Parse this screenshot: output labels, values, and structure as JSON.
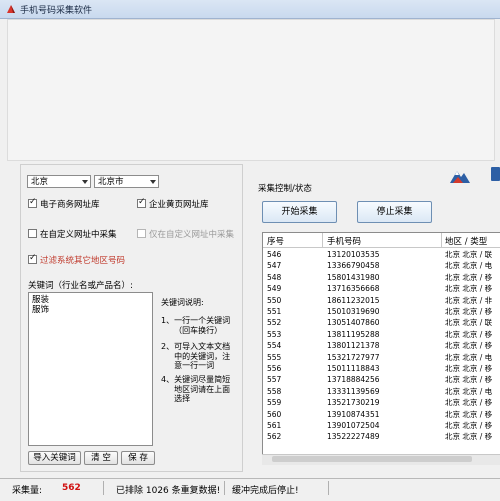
{
  "window": {
    "title": "手机号码采集软件"
  },
  "left": {
    "province_select": "北京",
    "city_select": "北京市",
    "options": {
      "ecommerce": {
        "label": "电子商务网址库",
        "checked": true
      },
      "yellowpages": {
        "label": "企业黄页网址库",
        "checked": true
      },
      "custom_url": {
        "label": "在自定义网址中采集",
        "checked": false
      },
      "custom_only": {
        "label": "仅在自定义网址中采集",
        "checked": false
      },
      "filter_other": {
        "label": "过滤系统其它地区号码",
        "checked": true
      }
    },
    "keywords_label": "关键词（行业名或产品名）:",
    "keywords_lines": [
      "服装",
      "服饰"
    ],
    "help_title": "关键词说明:",
    "help_items": [
      {
        "num": "1、",
        "lines": [
          "一行一个关键词",
          "（回车换行）"
        ]
      },
      {
        "num": "2、",
        "lines": [
          "可导入文本文档",
          "中的关键词，注",
          "意一行一词"
        ]
      },
      {
        "num": "4、",
        "lines": [
          "关键词尽量简短",
          "地区词请在上面",
          "选择"
        ]
      }
    ],
    "buttons": {
      "import": "导入关键词",
      "clear": "清 空",
      "save": "保 存"
    }
  },
  "right": {
    "section_title": "采集控制/状态",
    "start_button": "开始采集",
    "stop_button": "停止采集",
    "columns": [
      "序号",
      "手机号码",
      "地区 / 类型"
    ],
    "rows": [
      {
        "no": "546",
        "phone": "13120103535",
        "region": "北京 北京 / 联"
      },
      {
        "no": "547",
        "phone": "13366790458",
        "region": "北京 北京 / 电"
      },
      {
        "no": "548",
        "phone": "15801431980",
        "region": "北京 北京 / 移"
      },
      {
        "no": "549",
        "phone": "13716356668",
        "region": "北京 北京 / 移"
      },
      {
        "no": "550",
        "phone": "18611232015",
        "region": "北京 北京 / 非"
      },
      {
        "no": "551",
        "phone": "15010319690",
        "region": "北京 北京 / 移"
      },
      {
        "no": "552",
        "phone": "13051407860",
        "region": "北京 北京 / 联"
      },
      {
        "no": "553",
        "phone": "13811195288",
        "region": "北京 北京 / 移"
      },
      {
        "no": "554",
        "phone": "13801121378",
        "region": "北京 北京 / 移"
      },
      {
        "no": "555",
        "phone": "15321727977",
        "region": "北京 北京 / 电"
      },
      {
        "no": "556",
        "phone": "15011118843",
        "region": "北京 北京 / 移"
      },
      {
        "no": "557",
        "phone": "13718884256",
        "region": "北京 北京 / 移"
      },
      {
        "no": "558",
        "phone": "13331139569",
        "region": "北京 北京 / 电"
      },
      {
        "no": "559",
        "phone": "13521730219",
        "region": "北京 北京 / 移"
      },
      {
        "no": "560",
        "phone": "13910874351",
        "region": "北京 北京 / 移"
      },
      {
        "no": "561",
        "phone": "13901072504",
        "region": "北京 北京 / 移"
      },
      {
        "no": "562",
        "phone": "13522227489",
        "region": "北京 北京 / 移"
      }
    ]
  },
  "status": {
    "count_label": "采集量:",
    "count_value": "562",
    "dedupe_text": "已排除 1026 条重复数据!",
    "state_text": "缓冲完成后停止!"
  },
  "colors": {
    "accent_red": "#c0392b",
    "count_red": "#d01010"
  }
}
